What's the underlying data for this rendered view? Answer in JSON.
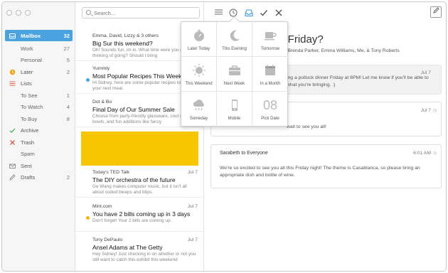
{
  "window": {
    "controls": [
      "close",
      "minimize",
      "zoom"
    ]
  },
  "sidebar": {
    "items": [
      {
        "label": "Mailbox",
        "count": "32",
        "icon": "inbox-icon",
        "active": true
      },
      {
        "label": "Work",
        "count": "27",
        "sub": true
      },
      {
        "label": "Personal",
        "count": "5",
        "sub": true
      },
      {
        "label": "Later",
        "count": "2",
        "icon": "clock-icon"
      },
      {
        "label": "Lists",
        "count": "",
        "icon": "list-icon"
      },
      {
        "label": "To See",
        "count": "1",
        "sub": true
      },
      {
        "label": "To Watch",
        "count": "4",
        "sub": true
      },
      {
        "label": "To Buy",
        "count": "8",
        "sub": true
      },
      {
        "label": "Archive",
        "count": "",
        "icon": "check-icon"
      },
      {
        "label": "Trash",
        "count": "",
        "icon": "x-icon"
      },
      {
        "label": "Spam",
        "count": "",
        "sub": true
      },
      {
        "label": "Sent",
        "count": "",
        "icon": "envelope-icon"
      },
      {
        "label": "Drafts",
        "count": "2",
        "icon": "pencil-icon"
      }
    ]
  },
  "search": {
    "placeholder": "Search..."
  },
  "messages": [
    {
      "from": "Emma, David, Lizzy & 3 others",
      "date": "",
      "subject": "Big Sur this weekend?",
      "preview": "Oh! Sounds fun, im in. What time were you guys thinking of going? Should I bring",
      "dot": ""
    },
    {
      "from": "Yummly",
      "date": "",
      "subject": "Most Popular Recipes This Week",
      "preview": "Hi Sidney, here are some popular recipes to inspire your next meal.",
      "dot": "#4aa3df"
    },
    {
      "from": "Dot & Bo",
      "date": "",
      "subject": "Final Day of Our Summer Sale",
      "preview": "Choose from party-friendly glassware, cool serving bowls, and fun additions like fancy",
      "dot": ""
    },
    {
      "from": "Today's TED Talk",
      "date": "Jul 7",
      "subject": "The DIY orchestra of the future",
      "preview": "Ge Wang makes computer music, but it isn't all about coded bleeps and blips.",
      "dot": ""
    },
    {
      "from": "Mint.com",
      "date": "Jul 7",
      "subject": "You have 2 bills coming up in 3 days",
      "preview": "Don't forget! Your 2 bills are coming up.",
      "dot": "#f2b705"
    },
    {
      "from": "Tony DePaulo",
      "date": "Jul 7",
      "subject": "Ansel Adams at The Getty",
      "preview": "Hey Sidney! Just checking in on whether or not you still want to catch this exhibit this weekend",
      "dot": ""
    }
  ],
  "toolbar": {
    "buttons": [
      "list-icon",
      "clock-icon",
      "archive-tray-icon",
      "check-icon",
      "close-icon",
      "compose-icon"
    ]
  },
  "thread": {
    "title": "s Friday?",
    "participants": "on, Brenda Parker, Emma Williams, Me, & Tony Roberts",
    "cards": [
      {
        "from": "",
        "date": "Jul 7",
        "body": "ing a potluck dinner Friday at 8PM! Let me know if you'll be able to what you're bringing. :)"
      },
      {
        "from": "",
        "date": "Jul 7",
        "body": "wait to see you all!"
      },
      {
        "from": "Sarabeth to Everyone",
        "date": "6:01 AM",
        "body": "We're so excited to see you all this Friday night! The theme is Casablanca, so please bring an appropriate dish and bottle of wine."
      }
    ]
  },
  "snooze": {
    "options": [
      {
        "label": "Later Today",
        "icon": "stopwatch-icon"
      },
      {
        "label": "This Evening",
        "icon": "moon-icon"
      },
      {
        "label": "Tomorrow",
        "icon": "coffee-cup-icon"
      },
      {
        "label": "This Weekend",
        "icon": "sun-icon"
      },
      {
        "label": "Next Week",
        "icon": "briefcase-icon"
      },
      {
        "label": "In a Month",
        "icon": "calendar-icon"
      },
      {
        "label": "Someday",
        "icon": "cloud-rain-icon"
      },
      {
        "label": "Mobile",
        "icon": "phone-icon"
      },
      {
        "label": "Pick Date",
        "icon": "pick-date-icon",
        "number": "08"
      }
    ]
  }
}
